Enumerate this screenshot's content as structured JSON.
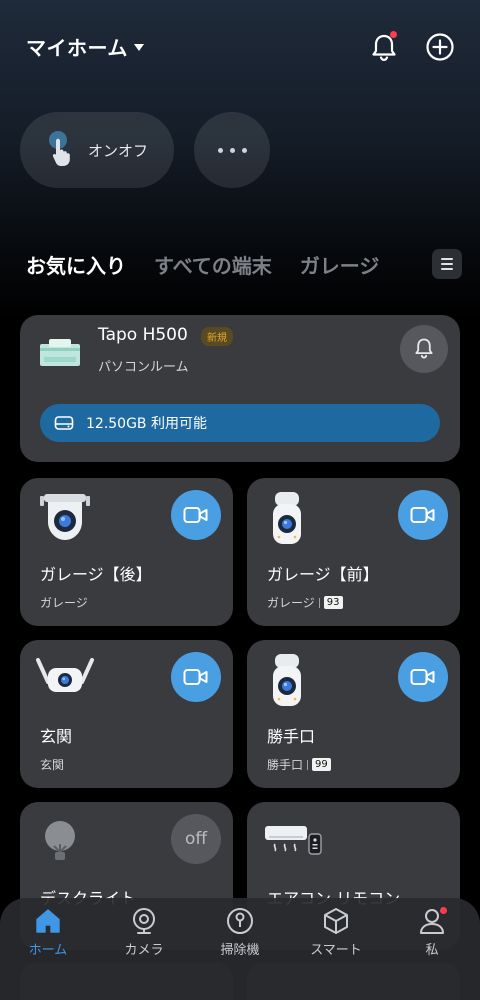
{
  "header": {
    "title": "マイホーム"
  },
  "quick": {
    "onoff_label": "オンオフ"
  },
  "tabs": [
    {
      "label": "お気に入り",
      "active": true
    },
    {
      "label": "すべての端末",
      "active": false
    },
    {
      "label": "ガレージ",
      "active": false
    }
  ],
  "hub": {
    "name": "Tapo H500",
    "badge": "新規",
    "room": "パソコンルーム",
    "storage": "12.50GB 利用可能"
  },
  "devices": [
    {
      "name": "ガレージ【後】",
      "room": "ガレージ",
      "count": "",
      "action": "camera"
    },
    {
      "name": "ガレージ【前】",
      "room": "ガレージ",
      "count": "93",
      "action": "camera"
    },
    {
      "name": "玄関",
      "room": "玄関",
      "count": "",
      "action": "camera"
    },
    {
      "name": "勝手口",
      "room": "勝手口",
      "count": "99",
      "action": "camera"
    },
    {
      "name": "デスクライト",
      "room": "",
      "count": "",
      "action": "off",
      "action_label": "off"
    },
    {
      "name": "エアコン リモコン",
      "room": "",
      "count": "",
      "action": "none"
    }
  ],
  "nav": [
    {
      "label": "ホーム",
      "icon": "home-icon",
      "active": true
    },
    {
      "label": "カメラ",
      "icon": "camera-icon",
      "active": false
    },
    {
      "label": "掃除機",
      "icon": "robot-vacuum-icon",
      "active": false
    },
    {
      "label": "スマート",
      "icon": "cube-icon",
      "active": false
    },
    {
      "label": "私",
      "icon": "person-icon",
      "active": false,
      "badge": true
    }
  ],
  "colors": {
    "accent": "#3f97e6",
    "camera_button": "#4a9fe3",
    "storage_bar": "#1e6aa0",
    "notification_dot": "#ff3b4e",
    "card": "#3a3b3f"
  }
}
